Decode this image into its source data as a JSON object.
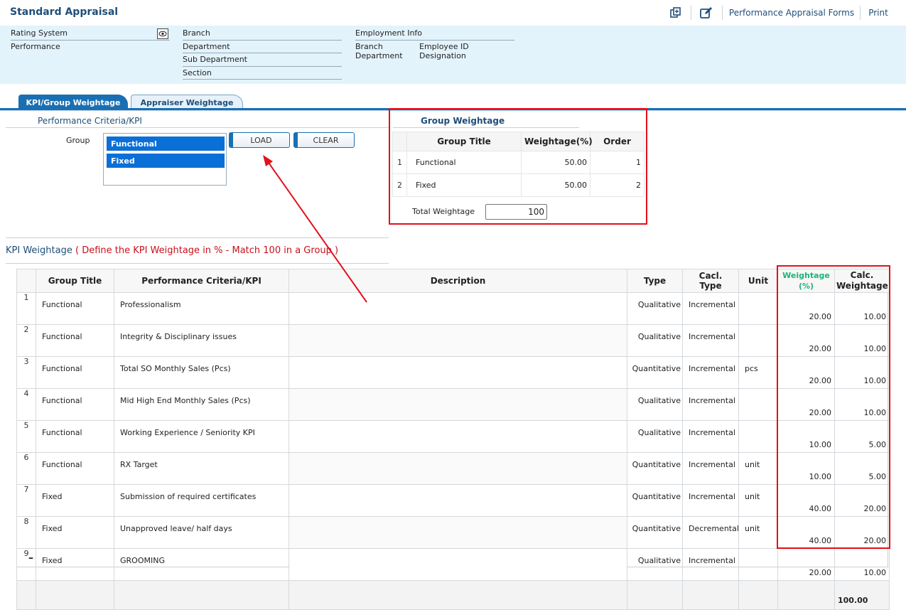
{
  "header": {
    "title": "Standard Appraisal",
    "forms_link": "Performance Appraisal Forms",
    "print_link": "Print"
  },
  "info": {
    "rating_system_label": "Rating System",
    "performance_label": "Performance",
    "branch_label": "Branch",
    "department_label": "Department",
    "sub_department_label": "Sub Department",
    "section_label": "Section",
    "employment_info_label": "Employment Info",
    "emp_branch_label": "Branch",
    "emp_department_label": "Department",
    "employee_id_label": "Employee ID",
    "designation_label": "Designation"
  },
  "tabs": [
    {
      "label": "KPI/Group Weightage",
      "active": true
    },
    {
      "label": "Appraiser Weightage",
      "active": false
    }
  ],
  "criteria": {
    "title": "Performance Criteria/KPI",
    "group_label": "Group",
    "groups": [
      "Functional",
      "Fixed"
    ],
    "load_button": "LOAD",
    "clear_button": "CLEAR"
  },
  "group_weightage": {
    "title": "Group Weightage",
    "columns": [
      "Group Title",
      "Weightage(%)",
      "Order"
    ],
    "rows": [
      {
        "n": "1",
        "title": "Functional",
        "weightage": "50.00",
        "order": "1"
      },
      {
        "n": "2",
        "title": "Fixed",
        "weightage": "50.00",
        "order": "2"
      }
    ],
    "total_label": "Total Weightage",
    "total_value": "100"
  },
  "kpi": {
    "title": "KPI Weightage",
    "note": "( Define the KPI Weightage in % - Match 100 in a Group )",
    "columns": {
      "group_title": "Group Title",
      "criteria": "Performance Criteria/KPI",
      "description": "Description",
      "type": "Type",
      "calc_type": "Cacl. Type",
      "unit": "Unit",
      "weightage_line1": "Weightage",
      "weightage_line2": "(%)",
      "calc_line1": "Calc.",
      "calc_line2": "Weightage"
    },
    "rows": [
      {
        "n": "1",
        "group": "Functional",
        "kpi": "Professionalism",
        "desc": "",
        "type": "Qualitative",
        "calc": "Incremental",
        "unit": "",
        "weight": "20.00",
        "calcw": "10.00"
      },
      {
        "n": "2",
        "group": "Functional",
        "kpi": "Integrity & Disciplinary issues",
        "desc": "",
        "type": "Qualitative",
        "calc": "Incremental",
        "unit": "",
        "weight": "20.00",
        "calcw": "10.00"
      },
      {
        "n": "3",
        "group": "Functional",
        "kpi": "Total SO Monthly Sales (Pcs)",
        "desc": "",
        "type": "Quantitative",
        "calc": "Incremental",
        "unit": "pcs",
        "weight": "20.00",
        "calcw": "10.00"
      },
      {
        "n": "4",
        "group": "Functional",
        "kpi": "Mid High End Monthly Sales (Pcs)",
        "desc": "",
        "type": "Qualitative",
        "calc": "Incremental",
        "unit": "",
        "weight": "20.00",
        "calcw": "10.00"
      },
      {
        "n": "5",
        "group": "Functional",
        "kpi": "Working Experience / Seniority KPI",
        "desc": "",
        "type": "Qualitative",
        "calc": "Incremental",
        "unit": "",
        "weight": "10.00",
        "calcw": "5.00"
      },
      {
        "n": "6",
        "group": "Functional",
        "kpi": "RX Target",
        "desc": "",
        "type": "Quantitative",
        "calc": "Incremental",
        "unit": "unit",
        "weight": "10.00",
        "calcw": "5.00"
      },
      {
        "n": "7",
        "group": "Fixed",
        "kpi": "Submission of required certificates",
        "desc": "",
        "type": "Quantitative",
        "calc": "Incremental",
        "unit": "unit",
        "weight": "40.00",
        "calcw": "20.00"
      },
      {
        "n": "8",
        "group": "Fixed",
        "kpi": "Unapproved leave/ half days",
        "desc": "",
        "type": "Quantitative",
        "calc": "Decremental",
        "unit": "unit",
        "weight": "40.00",
        "calcw": "20.00"
      },
      {
        "n": "9",
        "group": "Fixed",
        "kpi": "GROOMING",
        "desc": "",
        "type": "Qualitative",
        "calc": "Incremental",
        "unit": "",
        "weight": "20.00",
        "calcw": "10.00"
      }
    ],
    "total_calc": "100.00",
    "collapse_glyph": "–"
  },
  "colors": {
    "title_blue": "#1f4e79",
    "selection_blue": "#0a6fd6",
    "annotation_red": "#e2101b",
    "weightage_header_green": "#1fb37a"
  },
  "icons": [
    "eye-icon",
    "copy-icon",
    "edit-icon"
  ]
}
